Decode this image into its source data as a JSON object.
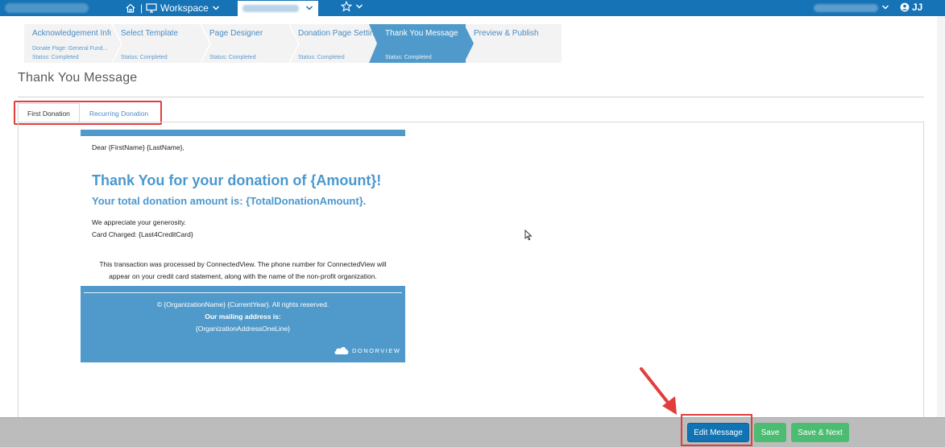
{
  "topbar": {
    "workspace_label": "Workspace",
    "user_initials": "JJ",
    "separator": "|"
  },
  "steps": [
    {
      "title": "Acknowledgement Info",
      "sub": "Donate Page: General Fund...",
      "status": "Status: Completed",
      "active": false
    },
    {
      "title": "Select Template",
      "sub": "",
      "status": "Status: Completed",
      "active": false
    },
    {
      "title": "Page Designer",
      "sub": "",
      "status": "Status: Completed",
      "active": false
    },
    {
      "title": "Donation Page Settings",
      "sub": "",
      "status": "Status: Completed",
      "active": false
    },
    {
      "title": "Thank You Message",
      "sub": "",
      "status": "Status: Completed",
      "active": true
    },
    {
      "title": "Preview & Publish",
      "sub": "",
      "status": "",
      "active": false
    }
  ],
  "page_title": "Thank You Message",
  "tabs": [
    {
      "label": "First Donation",
      "active": true
    },
    {
      "label": "Recurring Donation",
      "active": false
    }
  ],
  "email": {
    "greeting": "Dear {FirstName} {LastName},",
    "heading": "Thank You for your donation of {Amount}!",
    "subheading": "Your total donation amount is: {TotalDonationAmount}.",
    "line1": "We appreciate your generosity.",
    "line2": "Card Charged: {Last4CreditCard}",
    "note": "This transaction was processed by ConnectedView. The phone number for ConnectedView will appear on your credit card statement, along with the name of the non-profit organization.",
    "footer_copyright": "© {OrganizationName} {CurrentYear}. All rights reserved.",
    "footer_mailing_label": "Our mailing address is:",
    "footer_address": "{OrganizationAddressOneLine}",
    "logo_text": "DONORVIEW"
  },
  "buttons": {
    "edit_message": "Edit Message",
    "save": "Save",
    "save_next": "Save & Next"
  },
  "colors": {
    "nav_blue": "#1573b6",
    "step_active": "#4f9acb",
    "accent_text": "#4a98cf",
    "primary_button": "#1173b4",
    "success_button": "#4cbc72",
    "annotation_red": "#e23d3d"
  }
}
